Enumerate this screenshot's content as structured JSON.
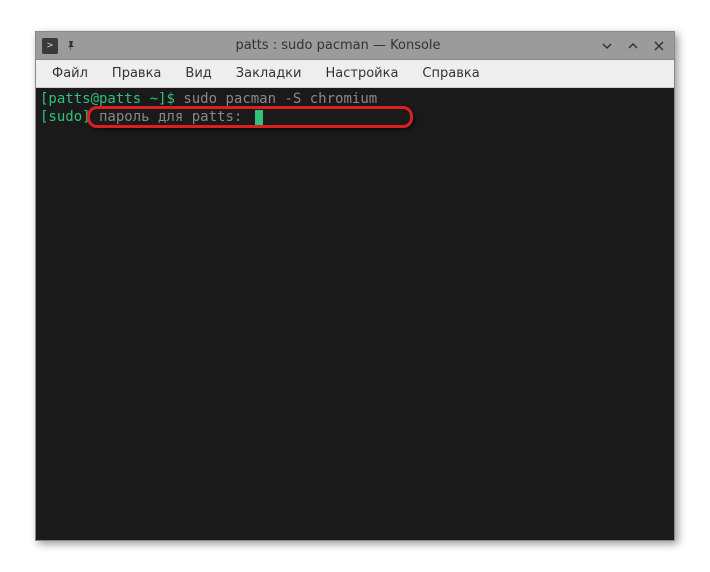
{
  "window": {
    "title": "patts : sudo pacman — Konsole"
  },
  "menubar": {
    "items": [
      {
        "label": "Файл"
      },
      {
        "label": "Правка"
      },
      {
        "label": "Вид"
      },
      {
        "label": "Закладки"
      },
      {
        "label": "Настройка"
      },
      {
        "label": "Справка"
      }
    ]
  },
  "terminal": {
    "line1": {
      "prompt_user_host": "[patts@patts",
      "prompt_path": " ~]",
      "prompt_symbol": "$ ",
      "command": "sudo pacman -S chromium"
    },
    "line2": {
      "sudo_prefix": "[sudo]",
      "password_prompt": " пароль для patts: "
    }
  }
}
